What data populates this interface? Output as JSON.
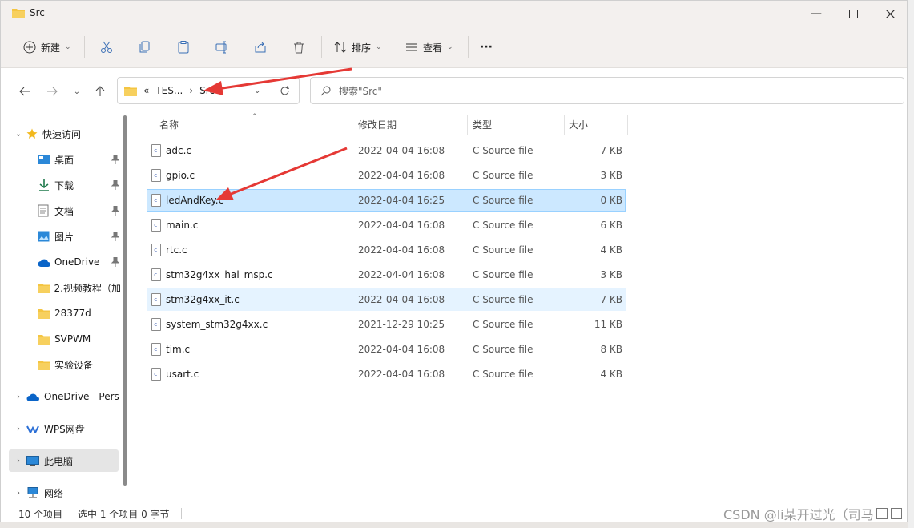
{
  "window": {
    "title": "Src"
  },
  "toolbar": {
    "new_label": "新建",
    "sort_label": "排序",
    "view_label": "查看",
    "more_label": "···"
  },
  "address": {
    "prefix": "«",
    "crumb1": "TES...",
    "sep": "›",
    "crumb2": "Src"
  },
  "search": {
    "placeholder": "搜索\"Src\""
  },
  "sidebar": {
    "items": [
      {
        "label": "快速访问",
        "icon": "star-icon",
        "pinned": false
      },
      {
        "label": "桌面",
        "icon": "desktop-icon",
        "pinned": true
      },
      {
        "label": "下载",
        "icon": "download-icon",
        "pinned": true
      },
      {
        "label": "文档",
        "icon": "document-icon",
        "pinned": true
      },
      {
        "label": "图片",
        "icon": "picture-icon",
        "pinned": true
      },
      {
        "label": "OneDrive",
        "icon": "cloud-icon",
        "pinned": true
      },
      {
        "label": "2.视频教程（加",
        "icon": "folder-icon",
        "pinned": false
      },
      {
        "label": "28377d",
        "icon": "folder-icon",
        "pinned": false
      },
      {
        "label": "SVPWM",
        "icon": "folder-icon",
        "pinned": false
      },
      {
        "label": "实验设备",
        "icon": "folder-icon",
        "pinned": false
      },
      {
        "label": "OneDrive - Pers",
        "icon": "cloud-icon",
        "pinned": false
      },
      {
        "label": "WPS网盘",
        "icon": "wps-cloud-icon",
        "pinned": false
      },
      {
        "label": "此电脑",
        "icon": "pc-icon",
        "pinned": false
      },
      {
        "label": "网络",
        "icon": "network-icon",
        "pinned": false
      }
    ]
  },
  "columns": {
    "name": "名称",
    "date": "修改日期",
    "type": "类型",
    "size": "大小"
  },
  "files": [
    {
      "name": "adc.c",
      "date": "2022-04-04 16:08",
      "type": "C Source file",
      "size": "7 KB"
    },
    {
      "name": "gpio.c",
      "date": "2022-04-04 16:08",
      "type": "C Source file",
      "size": "3 KB"
    },
    {
      "name": "ledAndKey.c",
      "date": "2022-04-04 16:25",
      "type": "C Source file",
      "size": "0 KB"
    },
    {
      "name": "main.c",
      "date": "2022-04-04 16:08",
      "type": "C Source file",
      "size": "6 KB"
    },
    {
      "name": "rtc.c",
      "date": "2022-04-04 16:08",
      "type": "C Source file",
      "size": "4 KB"
    },
    {
      "name": "stm32g4xx_hal_msp.c",
      "date": "2022-04-04 16:08",
      "type": "C Source file",
      "size": "3 KB"
    },
    {
      "name": "stm32g4xx_it.c",
      "date": "2022-04-04 16:08",
      "type": "C Source file",
      "size": "7 KB"
    },
    {
      "name": "system_stm32g4xx.c",
      "date": "2021-12-29 10:25",
      "type": "C Source file",
      "size": "11 KB"
    },
    {
      "name": "tim.c",
      "date": "2022-04-04 16:08",
      "type": "C Source file",
      "size": "8 KB"
    },
    {
      "name": "usart.c",
      "date": "2022-04-04 16:08",
      "type": "C Source file",
      "size": "4 KB"
    }
  ],
  "status": {
    "count": "10 个项目",
    "selected": "选中 1 个项目 0 字节"
  },
  "watermark": "CSDN @li某开过光（司马",
  "colors": {
    "selected_row": "#cce8ff",
    "hover_row": "#e5f3ff",
    "annotation_arrow": "#e53935",
    "folder": "#f4c542"
  }
}
